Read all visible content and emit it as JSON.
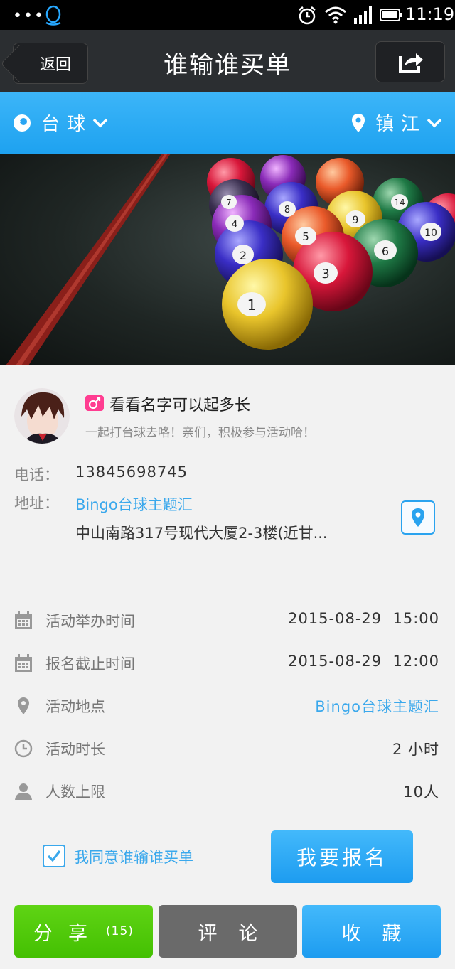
{
  "status_bar": {
    "dots": "•••",
    "time": "11:19"
  },
  "nav": {
    "back_label": "返回",
    "title": "谁输谁买单"
  },
  "filter": {
    "category": "台球",
    "city": "镇江"
  },
  "profile": {
    "username": "看看名字可以起多长",
    "slogan": "一起打台球去咯！亲们，积极参与活动哈！",
    "phone_label": "电话：",
    "phone": "13845698745",
    "address_label": "地址：",
    "address_name": "Bingo台球主题汇",
    "address_detail": "中山南路317号现代大厦2-3楼(近甘..."
  },
  "details": [
    {
      "icon": "calendar-icon",
      "label": "活动举办时间",
      "value": "2015-08-29  15:00"
    },
    {
      "icon": "calendar-icon",
      "label": "报名截止时间",
      "value": "2015-08-29  12:00"
    },
    {
      "icon": "location-pin-icon",
      "label": "活动地点",
      "value": "Bingo台球主题汇"
    },
    {
      "icon": "clock-icon",
      "label": "活动时长",
      "value": "2 小时"
    },
    {
      "icon": "person-icon",
      "label": "人数上限",
      "value": "10人"
    }
  ],
  "agree": {
    "text": "我同意谁输谁买单",
    "checked": true
  },
  "signup_label": "我要报名",
  "bottom": {
    "share_label": "分享",
    "share_count": "(15)",
    "comment_label": "评论",
    "fav_label": "收藏"
  },
  "colors": {
    "accent": "#1ea2f0",
    "share_green": "#4cc80a",
    "comment_gray": "#6a6a6a",
    "gender_pink": "#ff3d91"
  }
}
